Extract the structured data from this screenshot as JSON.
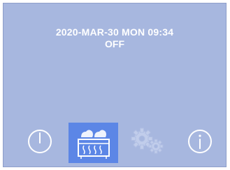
{
  "display": {
    "datetime": "2020-MAR-30 MON 09:34",
    "status": "OFF"
  },
  "buttons": {
    "power": {
      "icon": "power-icon",
      "selected": false
    },
    "mode": {
      "icon": "ventilation-heat-icon",
      "selected": true
    },
    "settings": {
      "icon": "gears-icon",
      "selected": false
    },
    "info": {
      "icon": "info-icon",
      "selected": false
    }
  },
  "colors": {
    "screen_background": "#a7b7df",
    "text": "#ffffff",
    "selected_highlight": "#5c86e6",
    "disabled_icon": "#b9c6e6"
  }
}
